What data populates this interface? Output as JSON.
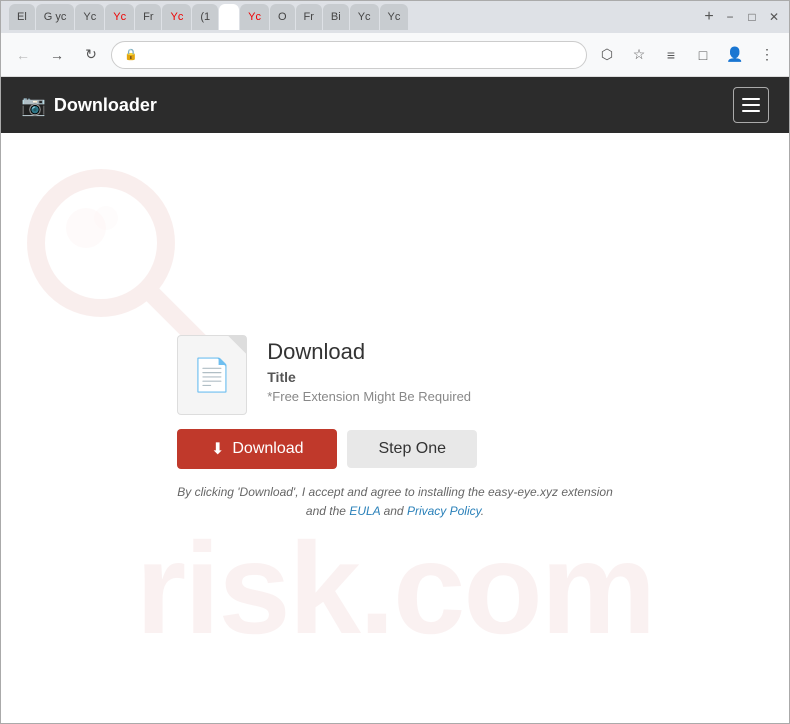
{
  "browser": {
    "tabs": [
      {
        "label": "El",
        "active": false
      },
      {
        "label": "G yc",
        "active": false
      },
      {
        "label": "Yc",
        "active": false
      },
      {
        "label": "Yc",
        "active": false
      },
      {
        "label": "Fr",
        "active": false
      },
      {
        "label": "Yc",
        "active": false
      },
      {
        "label": "(1",
        "active": false
      },
      {
        "label": "",
        "active": true
      },
      {
        "label": "Yc",
        "active": false
      },
      {
        "label": "O",
        "active": false
      },
      {
        "label": "Fr",
        "active": false
      },
      {
        "label": "Bi",
        "active": false
      },
      {
        "label": "Yc",
        "active": false
      },
      {
        "label": "Yc",
        "active": false
      }
    ],
    "controls": {
      "minimize": "−",
      "maximize": "□",
      "close": "✕"
    },
    "address": "lock"
  },
  "navbar": {
    "brand_icon": "📷",
    "brand_name": "Downloader"
  },
  "watermark": {
    "text": "risk.com"
  },
  "card": {
    "title": "Download",
    "subtitle": "Title",
    "note": "*Free Extension Might Be Required",
    "download_btn": "Download",
    "step_btn": "Step One",
    "disclaimer_text": "By clicking 'Download', I accept and agree to installing the easy-eye.xyz extension",
    "disclaimer_text2": "and the",
    "disclaimer_eula": "EULA",
    "disclaimer_and": "and",
    "disclaimer_privacy": "Privacy Policy",
    "disclaimer_period": "."
  }
}
